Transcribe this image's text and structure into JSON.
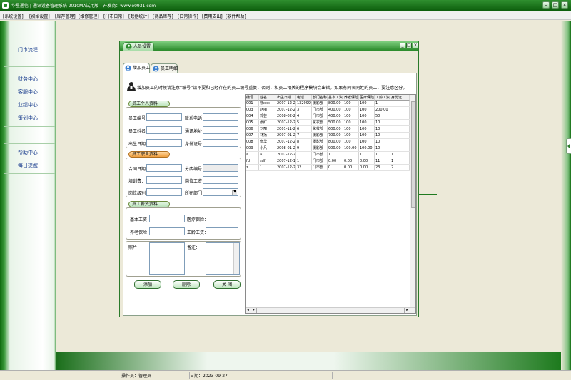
{
  "titlebar": {
    "title": "华星通信 | 通讯设备管理系统 2010MA试用版　开发商：www.e0931.com"
  },
  "menu": [
    "[系统设置]",
    "[初始设置]",
    "[库存管理]",
    "[维修管理]",
    "[门市日常]",
    "[数据统计]",
    "[商品库存]",
    "[日常操作]",
    "[费用支出]",
    "[软件帮助]"
  ],
  "nav": {
    "top": [
      "门市流程"
    ],
    "middle": [
      "财务中心",
      "客服中心",
      "业绩中心",
      "策划中心"
    ],
    "bottom": [
      "帮助中心",
      "每日提醒"
    ]
  },
  "dialog": {
    "title": "人员设置",
    "tabs": [
      "增加员工",
      "员工明细"
    ],
    "note": "增加员工的时候请注意“编号”请不要和已经存在的员工编号重复，否则，和员工相关的程序模块会出错。如果有同名同姓的员工，要注意区分。",
    "group_personal": "员工个人资料",
    "lbl_emp_no": "员工编号：",
    "lbl_contact_phone": "联系电话：",
    "lbl_emp_name": "员工姓名：",
    "lbl_address": "通讯地址：",
    "lbl_birthdate": "出生日期：",
    "lbl_id_card": "身份证号：",
    "group_job": "员工职业资料",
    "lbl_contract_date": "合同日期：",
    "lbl_store_no": "分店编号：",
    "lbl_training": "培训费：",
    "lbl_position_salary": "岗位工资",
    "lbl_position_level": "岗位级别：",
    "lbl_department": "所在部门：",
    "group_salary": "员工薪资资料",
    "lbl_base_salary": "基本工资：",
    "lbl_medical": "医疗保险：",
    "lbl_pension": "养老保险：",
    "lbl_seniority": "工龄工资：",
    "lbl_photo": "照片：",
    "lbl_remark": "备注：",
    "btn_add": "添加",
    "btn_delete": "删除",
    "btn_close": "关 闭"
  },
  "grid": {
    "columns": [
      "编号",
      "姓名",
      "出生日期",
      "电话",
      "部门名称",
      "基本工资",
      "养老保险",
      "医疗保险",
      "工龄工资",
      "身份证"
    ],
    "rows": [
      [
        "001",
        "徐xxx",
        "2007-12-21",
        "13299999",
        "摄影部",
        "800.00",
        "100",
        "100",
        "1",
        ""
      ],
      [
        "003",
        "赵丽",
        "2007-12-21",
        "3",
        "门市部",
        "400.00",
        "100",
        "100",
        "200.00",
        ""
      ],
      [
        "004",
        "郭芸",
        "2008-02-23",
        "4",
        "门市部",
        "400.00",
        "100",
        "100",
        "50",
        ""
      ],
      [
        "005",
        "张红",
        "2007-12-23",
        "5",
        "化妆部",
        "500.00",
        "100",
        "100",
        "10",
        ""
      ],
      [
        "006",
        "刘丽",
        "2001-11-21",
        "6",
        "化妆部",
        "600.00",
        "100",
        "100",
        "10",
        ""
      ],
      [
        "007",
        "林扬",
        "2007-01-26",
        "7",
        "摄影部",
        "700.00",
        "100",
        "100",
        "10",
        ""
      ],
      [
        "008",
        "佟华",
        "2007-12-21",
        "8",
        "摄影部",
        "800.00",
        "100",
        "100",
        "10",
        ""
      ],
      [
        "009",
        "小凡",
        "2008-01-22",
        "9",
        "摄影部",
        "900.00",
        "100.00",
        "100.00",
        "10",
        ""
      ],
      [
        "a",
        "a",
        "2007-12-21",
        "1",
        "门市部",
        "1",
        "1",
        "1",
        "1",
        "1"
      ],
      [
        "fd",
        "sdf",
        "2007-12-12",
        "1",
        "门市部",
        "0.00",
        "0.00",
        "0.00",
        "11",
        "1"
      ],
      [
        "z",
        "1",
        "2007-12-22",
        "32",
        "门市部",
        "0",
        "0.00",
        "0.00",
        "23",
        "2"
      ]
    ]
  },
  "status": {
    "operator": "操作员：管理员",
    "date": "日期：2023-09-27"
  }
}
